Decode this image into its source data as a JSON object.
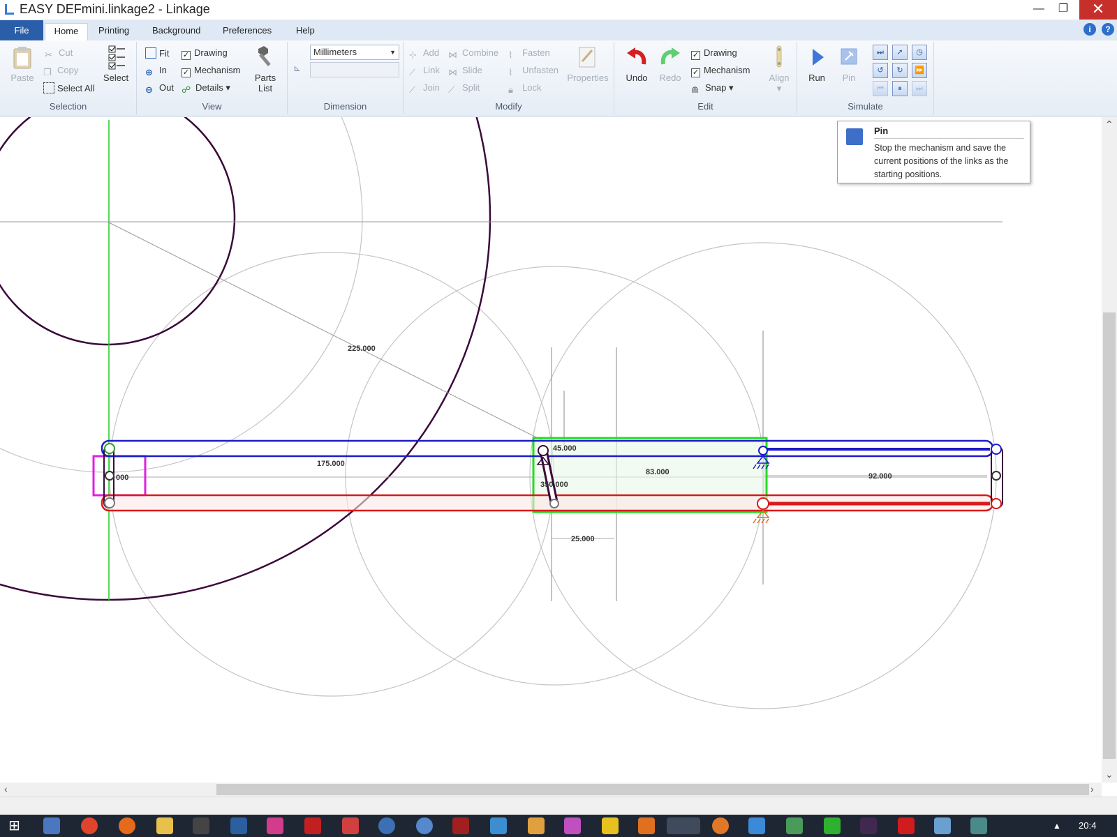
{
  "window": {
    "title": "EASY DEFmini.linkage2 - Linkage",
    "minimize": "—",
    "maximize": "❐",
    "close": "✕"
  },
  "menu": {
    "tabs": [
      "File",
      "Home",
      "Printing",
      "Background",
      "Preferences",
      "Help"
    ],
    "info_icon": "i",
    "help_icon": "?"
  },
  "ribbon": {
    "selection": {
      "label": "Selection",
      "paste": "Paste",
      "cut": "Cut",
      "copy": "Copy",
      "select_all": "Select All",
      "select": "Select"
    },
    "view": {
      "label": "View",
      "fit": "Fit",
      "in": "In",
      "out": "Out",
      "drawing": "Drawing",
      "mechanism": "Mechanism",
      "details": "Details",
      "parts_list_1": "Parts",
      "parts_list_2": "List"
    },
    "dimension": {
      "label": "Dimension",
      "units": "Millimeters",
      "value": ""
    },
    "modify": {
      "label": "Modify",
      "add": "Add",
      "link": "Link",
      "join": "Join",
      "combine": "Combine",
      "slide": "Slide",
      "split": "Split",
      "fasten": "Fasten",
      "unfasten": "Unfasten",
      "lock": "Lock",
      "properties": "Properties"
    },
    "edit": {
      "label": "Edit",
      "undo": "Undo",
      "redo": "Redo",
      "drawing": "Drawing",
      "mechanism": "Mechanism",
      "snap": "Snap",
      "align": "Align"
    },
    "simulate": {
      "label": "Simulate",
      "run": "Run",
      "pin": "Pin"
    }
  },
  "tooltip": {
    "title": "Pin",
    "description": "Stop the mechanism and save the current positions of the links as the starting positions."
  },
  "canvas": {
    "dimensions": [
      "225.000",
      "175.000",
      "45.000",
      "83.000",
      "92.000",
      "25.000",
      "350.000",
      "000"
    ]
  },
  "taskbar": {
    "clock": "20:4"
  },
  "colors": {
    "blue_link": "#1c1cc8",
    "red_link": "#d81b1b",
    "green_select": "#22dd22",
    "magenta_select": "#e020e0",
    "dark_link": "#3a0a3a"
  }
}
